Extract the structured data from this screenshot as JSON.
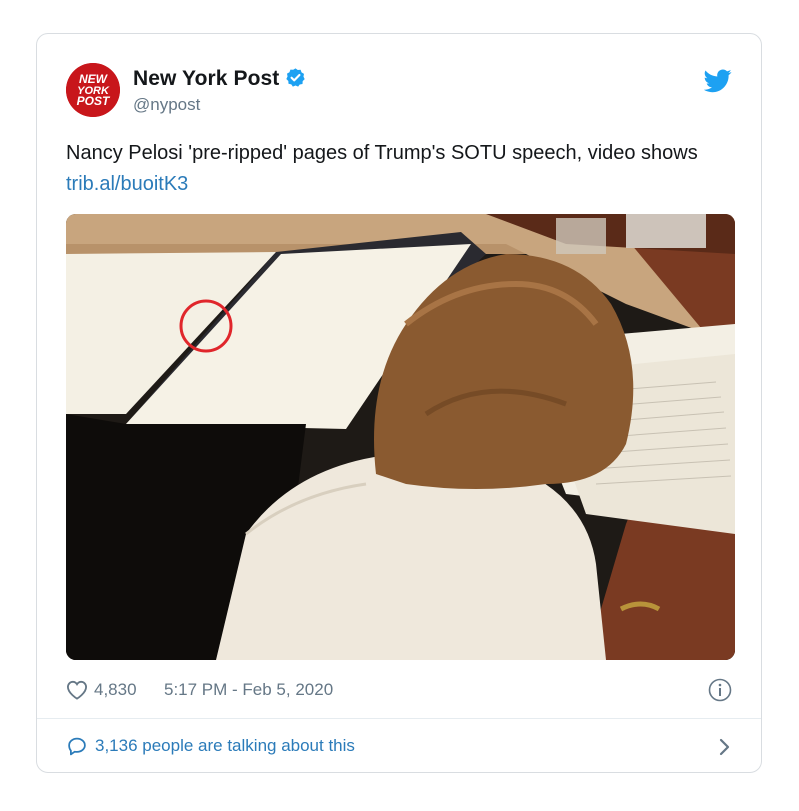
{
  "tweet": {
    "author": {
      "name": "New York Post",
      "handle": "@nypost",
      "verified": true,
      "avatar_logo_text": [
        "NEW",
        "YORK",
        "POST"
      ]
    },
    "text": "Nancy Pelosi 'pre-ripped' pages of Trump's SOTU speech, video shows ",
    "link_text": "trib.al/buoitK3",
    "media": {
      "icon": "photo",
      "description_colors": {
        "desk": "#8a4a2a",
        "paper": "#f4f0e4",
        "hair": "#8a5a30",
        "jacket": "#efe8dc",
        "highlight_circle": "#e0262b"
      }
    },
    "likes": "4,830",
    "timestamp": "5:17 PM - Feb 5, 2020",
    "conversation_label": "3,136 people are talking about this"
  },
  "colors": {
    "brand_blue": "#1da1f2",
    "link_blue": "#2b7bb9",
    "muted_text": "#657786",
    "text": "#14171a",
    "border": "#d9dde1",
    "nypost_red": "#c8161b"
  }
}
